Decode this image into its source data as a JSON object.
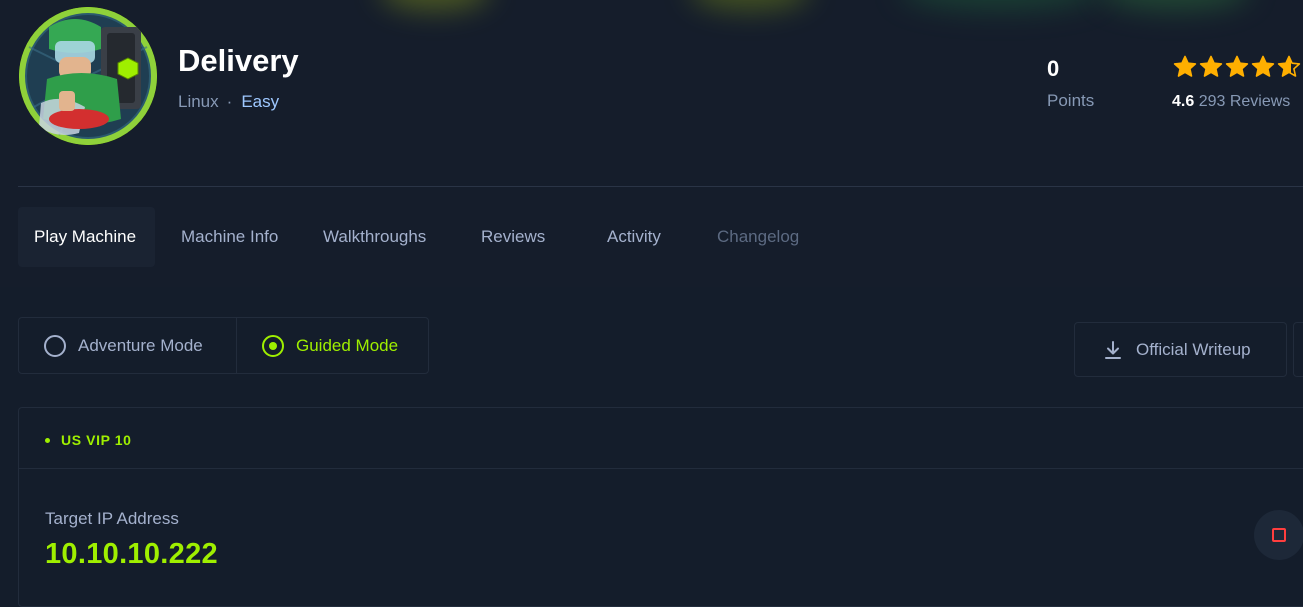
{
  "machine": {
    "name": "Delivery",
    "os": "Linux",
    "separator": "·",
    "difficulty": "Easy",
    "avatar_icon": "delivery-rider-avatar"
  },
  "stats": {
    "points_value": "0",
    "points_label": "Points",
    "rating_stars": 4.6,
    "rating_score": "4.6",
    "reviews_text": "293 Reviews"
  },
  "tabs": [
    {
      "label": "Play Machine",
      "active": true
    },
    {
      "label": "Machine Info"
    },
    {
      "label": "Walkthroughs"
    },
    {
      "label": "Reviews"
    },
    {
      "label": "Activity"
    },
    {
      "label": "Changelog",
      "disabled": true
    }
  ],
  "modes": {
    "adventure_label": "Adventure Mode",
    "guided_label": "Guided Mode",
    "selected": "guided"
  },
  "writeup": {
    "label": "Official Writeup",
    "icon": "download-icon"
  },
  "connection": {
    "server": "US VIP 10",
    "ip_label": "Target IP Address",
    "ip": "10.10.10.222"
  },
  "colors": {
    "accent": "#9fef00",
    "background": "#141d2b",
    "star": "#ffaf00",
    "stop": "#ff3e3e",
    "link": "#9ec8ff"
  }
}
